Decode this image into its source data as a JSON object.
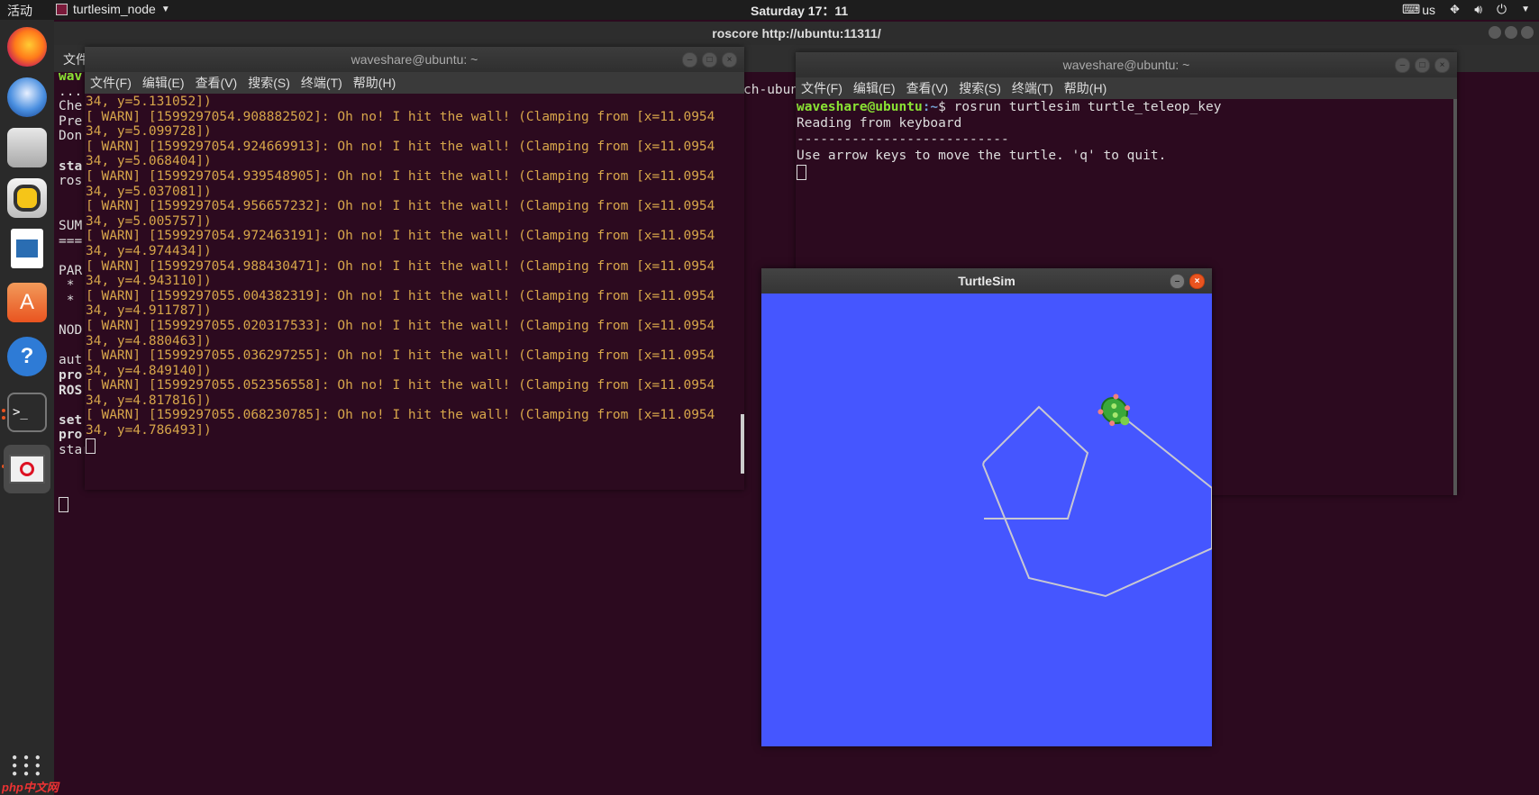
{
  "topbar": {
    "activities": "活动",
    "app_name": "turtlesim_node",
    "clock": "Saturday 17：11",
    "keyboard": "us"
  },
  "bg_window": {
    "title": "roscore http://ubuntu:11311/",
    "menu_first": "文件",
    "lines": [
      "wav",
      "...",
      "Che",
      "Pre",
      "Don",
      "",
      "sta",
      "ros",
      "",
      "",
      "SUM",
      "===",
      "",
      "PAR",
      " *",
      " *",
      "",
      "NOD",
      "",
      "aut",
      "pro",
      "ROS",
      "",
      "set",
      "pro",
      "started core service [/rosout]"
    ],
    "bold_line_indexes": [
      0,
      6,
      20,
      21,
      23,
      24
    ],
    "snippet_right": "ch-ubun"
  },
  "left_terminal": {
    "title": "waveshare@ubuntu: ~",
    "menu": [
      "文件(F)",
      "编辑(E)",
      "查看(V)",
      "搜索(S)",
      "终端(T)",
      "帮助(H)"
    ],
    "first_line": "34, y=5.131052])",
    "warnings": [
      {
        "ts": "1599297054.908882502",
        "y": "5.099728"
      },
      {
        "ts": "1599297054.924669913",
        "y": "5.068404"
      },
      {
        "ts": "1599297054.939548905",
        "y": "5.037081"
      },
      {
        "ts": "1599297054.956657232",
        "y": "5.005757"
      },
      {
        "ts": "1599297054.972463191",
        "y": "4.974434"
      },
      {
        "ts": "1599297054.988430471",
        "y": "4.943110"
      },
      {
        "ts": "1599297055.004382319",
        "y": "4.911787"
      },
      {
        "ts": "1599297055.020317533",
        "y": "4.880463"
      },
      {
        "ts": "1599297055.036297255",
        "y": "4.849140"
      },
      {
        "ts": "1599297055.052356558",
        "y": "4.817816"
      },
      {
        "ts": "1599297055.068230785",
        "y": "4.786493"
      }
    ],
    "warn_prefix": "[ WARN] [",
    "warn_mid": "]: Oh no! I hit the wall! (Clamping from [x=11.0954",
    "warn_x_tail": "34, y="
  },
  "right_terminal": {
    "title": "waveshare@ubuntu: ~",
    "menu": [
      "文件(F)",
      "编辑(E)",
      "查看(V)",
      "搜索(S)",
      "终端(T)",
      "帮助(H)"
    ],
    "prompt_user": "waveshare@ubuntu",
    "prompt_path": ":~",
    "prompt_symbol": "$ ",
    "command": "rosrun turtlesim turtle_teleop_key",
    "output": [
      "Reading from keyboard",
      "---------------------------",
      "Use arrow keys to move the turtle. 'q' to quit."
    ]
  },
  "turtlesim": {
    "title": "TurtleSim",
    "background": "#4556ff",
    "pen": "#c8c8d2"
  },
  "dock": {
    "icons": [
      "firefox-icon",
      "thunderbird-icon",
      "files-icon",
      "rhythmbox-icon",
      "writer-icon",
      "software-icon",
      "help-icon",
      "terminal-icon",
      "blocked-app-icon",
      "app-grid-icon"
    ]
  },
  "watermark": "php中文网"
}
